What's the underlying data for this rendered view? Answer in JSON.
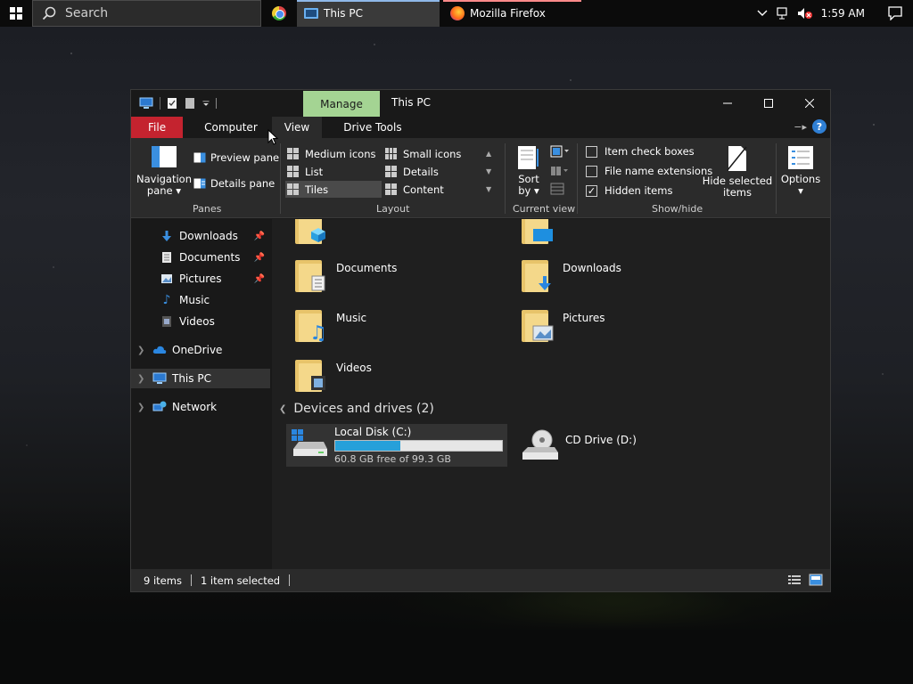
{
  "taskbar": {
    "search_placeholder": "Search",
    "tasks": [
      {
        "label": "This PC",
        "icon": "this-pc-icon"
      },
      {
        "label": "Mozilla Firefox",
        "icon": "firefox-icon"
      }
    ],
    "clock": "1:59 AM"
  },
  "window": {
    "title": "This PC",
    "contextual_tab": "Manage",
    "tabs": [
      "File",
      "Computer",
      "View",
      "Drive Tools"
    ],
    "active_tab": "View"
  },
  "ribbon": {
    "panes": {
      "group_label": "Panes",
      "navigation_pane": "Navigation",
      "navigation_pane_sub": "pane",
      "preview_pane": "Preview pane",
      "details_pane": "Details pane"
    },
    "layout": {
      "group_label": "Layout",
      "items": [
        "Medium icons",
        "Small icons",
        "List",
        "Details",
        "Tiles",
        "Content"
      ],
      "selected": "Tiles"
    },
    "current_view": {
      "group_label": "Current view",
      "sort_by": "Sort",
      "sort_by_sub": "by"
    },
    "show_hide": {
      "group_label": "Show/hide",
      "item_check_boxes": "Item check boxes",
      "file_name_extensions": "File name extensions",
      "hidden_items": "Hidden items",
      "hide_selected": "Hide selected",
      "hide_selected_sub": "items",
      "checks": {
        "item_check_boxes": false,
        "file_name_extensions": false,
        "hidden_items": true
      }
    },
    "options": "Options"
  },
  "nav": {
    "items": [
      {
        "label": "Downloads",
        "pinned": true
      },
      {
        "label": "Documents",
        "pinned": true
      },
      {
        "label": "Pictures",
        "pinned": true
      },
      {
        "label": "Music",
        "pinned": false
      },
      {
        "label": "Videos",
        "pinned": false
      },
      {
        "label": "OneDrive",
        "pinned": false
      },
      {
        "label": "This PC",
        "pinned": false
      },
      {
        "label": "Network",
        "pinned": false
      }
    ]
  },
  "content": {
    "folders": [
      {
        "name": "Documents"
      },
      {
        "name": "Downloads"
      },
      {
        "name": "Music"
      },
      {
        "name": "Pictures"
      },
      {
        "name": "Videos"
      }
    ],
    "section_header": "Devices and drives (2)",
    "drives": [
      {
        "name": "Local Disk (C:)",
        "free_text": "60.8 GB free of 99.3 GB",
        "used_fraction": 0.388
      },
      {
        "name": "CD Drive (D:)"
      }
    ]
  },
  "status": {
    "items_count": "9 items",
    "selected_count": "1 item selected"
  },
  "colors": {
    "file_tab": "#c4232f",
    "manage_tab": "#a4d493",
    "accent": "#26a0da"
  }
}
